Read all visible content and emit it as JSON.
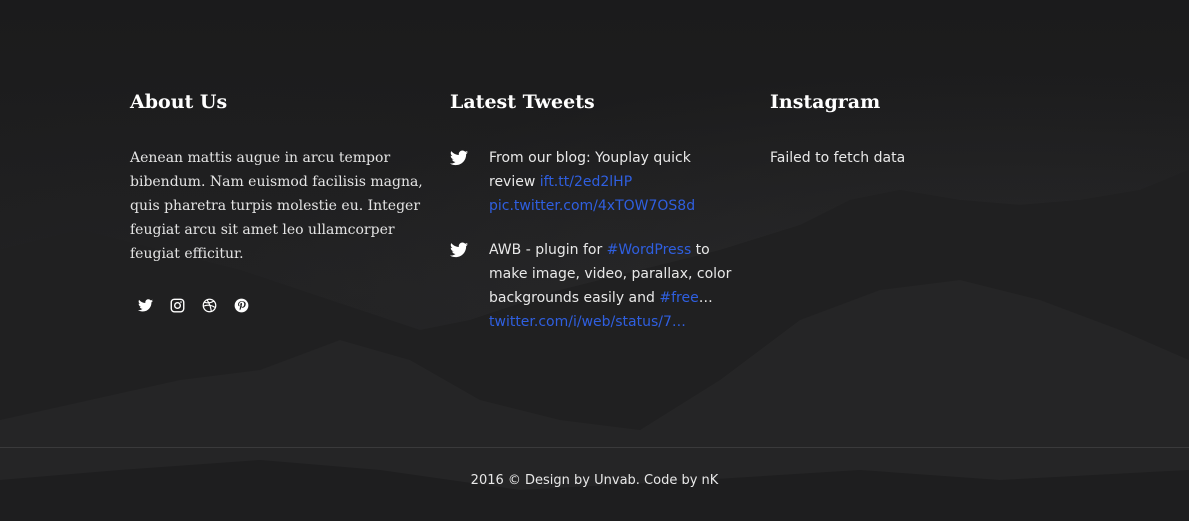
{
  "about": {
    "title": "About Us",
    "text": "Aenean mattis augue in arcu tempor bibendum. Nam euismod facilisis magna, quis pharetra turpis molestie eu. Integer feugiat arcu sit amet leo ullamcorper feugiat efficitur.",
    "social_icons": [
      "twitter-icon",
      "instagram-icon",
      "dribbble-icon",
      "pinterest-icon"
    ]
  },
  "tweets": {
    "title": "Latest Tweets",
    "items": [
      {
        "text_1": "From our blog: Youplay quick review ",
        "link_1": "ift.tt/2ed2lHP",
        "text_2": " ",
        "link_2": "pic.twitter.com/4xTOW7OS8d"
      },
      {
        "text_1": "AWB - plugin for ",
        "hashtag_1": "#WordPress",
        "text_2": " to make image, video, parallax, color backgrounds easily and ",
        "hashtag_2": "#free",
        "text_3": "… ",
        "link_1": "twitter.com/i/web/status/7…"
      }
    ]
  },
  "instagram": {
    "title": "Instagram",
    "status": "Failed to fetch data"
  },
  "footer": {
    "copyright": "2016 © Design by Unvab. Code by nK"
  },
  "colors": {
    "background": "#1c1c1d",
    "link": "#2f5fe0",
    "text": "#e8e8e8"
  }
}
